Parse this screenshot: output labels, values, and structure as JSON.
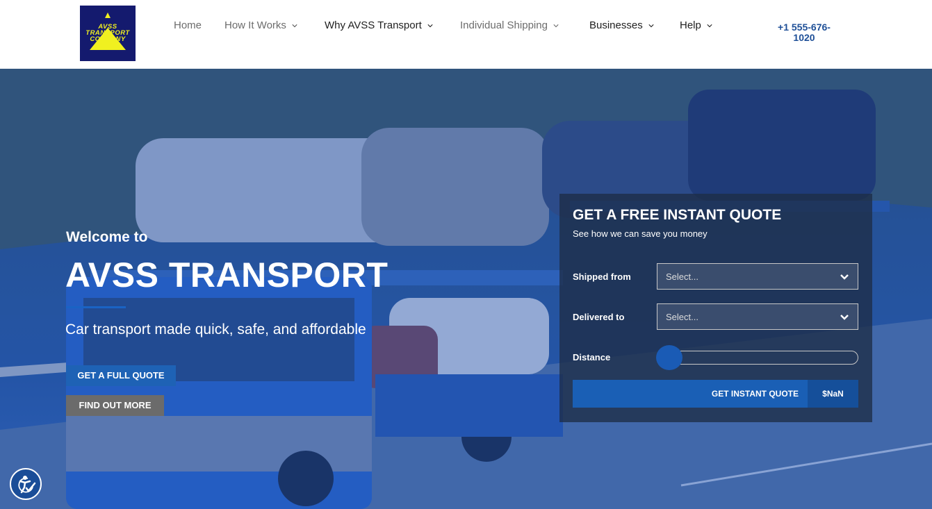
{
  "header": {
    "logo": {
      "name": "logo",
      "lines": [
        "AVSS",
        "TRANSPORT",
        "COMPANY"
      ]
    },
    "nav": [
      {
        "label": "Home",
        "has_dropdown": false
      },
      {
        "label": "How It Works",
        "has_dropdown": true
      },
      {
        "label": "Why AVSS Transport",
        "has_dropdown": true
      },
      {
        "label": "Individual Shipping",
        "has_dropdown": true
      },
      {
        "label": "Businesses",
        "has_dropdown": true
      },
      {
        "label": "Help",
        "has_dropdown": true
      }
    ],
    "phone_line1": "+1 555-676-",
    "phone_line2": "1020"
  },
  "hero": {
    "welcome": "Welcome to",
    "title": "AVSS TRANSPORT",
    "tagline": "Car transport made quick, safe, and affordable",
    "buttons": {
      "full_quote": "GET A FULL QUOTE",
      "find_out_more": "FIND OUT MORE"
    }
  },
  "quote": {
    "title": "GET A FREE INSTANT QUOTE",
    "subtitle": "See how we can save you money",
    "fields": {
      "shipped_from": {
        "label": "Shipped from",
        "placeholder": "Select..."
      },
      "delivered_to": {
        "label": "Delivered to",
        "placeholder": "Select..."
      },
      "distance": {
        "label": "Distance",
        "value": 0
      }
    },
    "submit_label": "GET INSTANT QUOTE",
    "price": "$NaN"
  },
  "colors": {
    "brand_blue": "#1a5fb5",
    "phone_blue": "#1e4f97",
    "logo_bg": "#141a6e",
    "logo_yellow": "#f0f020"
  },
  "icons": {
    "nav_dropdown": "chevron-down-icon",
    "select_dropdown": "chevron-down-icon",
    "accessibility": "accessibility-icon"
  }
}
